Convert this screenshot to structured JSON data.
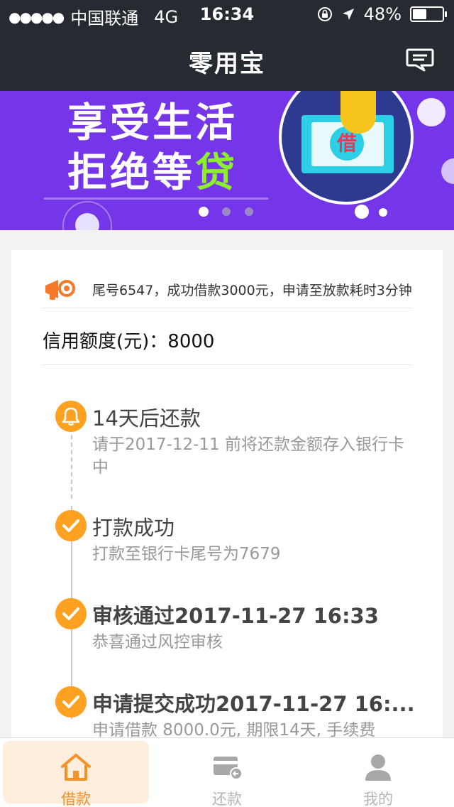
{
  "status_bar": {
    "carrier": "中国联通",
    "network": "4G",
    "time": "16:34",
    "battery_text": "48%",
    "battery_level": 0.48
  },
  "nav": {
    "title": "零用宝",
    "message_icon": "chat-bubble-icon"
  },
  "banner": {
    "line1": "享受生活",
    "line2_prefix": "拒绝等",
    "line2_highlight": "贷",
    "bill_text": "借",
    "slide_count": 3,
    "active_slide": 0
  },
  "notice": {
    "icon": "megaphone-icon",
    "text": "尾号6547，成功借款3000元，申请至放款耗时3分钟"
  },
  "credit": {
    "label": "信用额度(元)：",
    "value": "8000"
  },
  "timeline": [
    {
      "icon": "bell-icon",
      "title": "14天后还款",
      "desc": "请于2017-12-11 前将还款金额存入银行卡中"
    },
    {
      "icon": "check-icon",
      "title": "打款成功",
      "desc": "打款至银行卡尾号为7679"
    },
    {
      "icon": "check-icon",
      "title": "审核通过2017-11-27 16:33",
      "desc": "恭喜通过风控审核"
    },
    {
      "icon": "check-icon",
      "title": "申请提交成功2017-11-27 16:...",
      "desc": "申请借款 8000.0元, 期限14天, 手续费"
    }
  ],
  "tabs": [
    {
      "label": "借款",
      "icon": "home-icon",
      "active": true
    },
    {
      "label": "还款",
      "icon": "card-icon",
      "active": false
    },
    {
      "label": "我的",
      "icon": "user-icon",
      "active": false
    }
  ],
  "colors": {
    "dark_bar": "#262a31",
    "banner_purple": "#7436e8",
    "accent_orange": "#fea020",
    "banner_green": "#8cf02e"
  }
}
